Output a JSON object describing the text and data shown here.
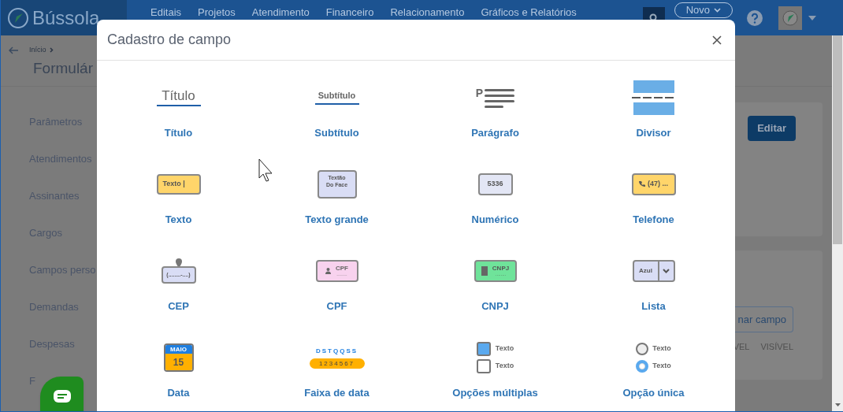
{
  "nav": {
    "logo": "Bússola",
    "items": [
      "Editais",
      "Projetos",
      "Atendimento",
      "Financeiro",
      "Relacionamento",
      "Gráficos e Relatórios"
    ],
    "new_button": "Novo"
  },
  "breadcrumb": "Início",
  "page_title": "Formulár",
  "sidebar": {
    "items": [
      "Parâmetros",
      "Atendimentos",
      "Assinantes",
      "Cargos",
      "Campos perso",
      "Demandas",
      "Despesas",
      "F"
    ]
  },
  "content": {
    "edit_button": "Editar",
    "add_button": "nar campo",
    "columns": [
      "VEL",
      "VISÍVEL"
    ]
  },
  "modal": {
    "title": "Cadastro de campo",
    "fields": [
      {
        "kind": "title",
        "label": "Título",
        "preview": [
          "Título"
        ]
      },
      {
        "kind": "subtitle",
        "label": "Subtítulo",
        "preview": [
          "Subtítulo"
        ]
      },
      {
        "kind": "paragraph",
        "label": "Parágrafo",
        "preview": [
          "P"
        ]
      },
      {
        "kind": "divider",
        "label": "Divisor"
      },
      {
        "kind": "text",
        "label": "Texto",
        "preview": [
          "Texto |"
        ]
      },
      {
        "kind": "textarea",
        "label": "Texto grande",
        "preview": [
          "Textão",
          "Do Face"
        ]
      },
      {
        "kind": "number",
        "label": "Numérico",
        "preview": [
          "5336"
        ]
      },
      {
        "kind": "phone",
        "label": "Telefone",
        "preview": [
          "(47) ..."
        ]
      },
      {
        "kind": "cep",
        "label": "CEP",
        "preview": [
          "(........-....)"
        ]
      },
      {
        "kind": "cpf",
        "label": "CPF",
        "preview": [
          "CPF",
          "........"
        ]
      },
      {
        "kind": "cnpj",
        "label": "CNPJ",
        "preview": [
          "CNPJ",
          "........"
        ]
      },
      {
        "kind": "list",
        "label": "Lista",
        "preview": [
          "Azul"
        ]
      },
      {
        "kind": "date",
        "label": "Data",
        "preview": [
          "MAIO",
          "15"
        ]
      },
      {
        "kind": "daterange",
        "label": "Faixa de data",
        "preview": [
          "DSTQQSS",
          "1234567"
        ]
      },
      {
        "kind": "checkboxes",
        "label": "Opções múltiplas",
        "options": [
          {
            "text": "Texto",
            "checked": true
          },
          {
            "text": "Texto",
            "checked": false
          }
        ]
      },
      {
        "kind": "radios",
        "label": "Opção única",
        "options": [
          {
            "text": "Texto",
            "selected": false
          },
          {
            "text": "Texto",
            "selected": true
          }
        ]
      }
    ]
  }
}
